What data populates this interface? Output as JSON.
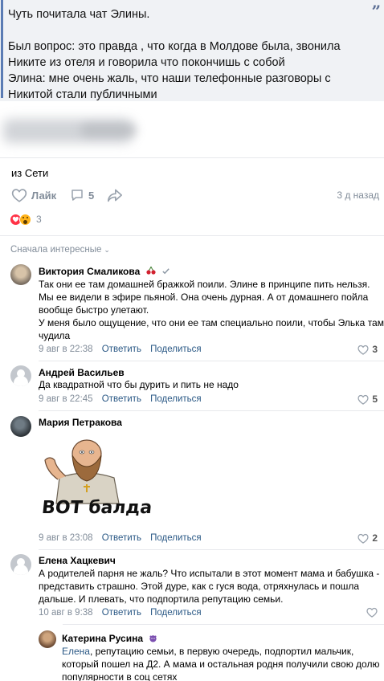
{
  "post": {
    "quote_lines": [
      "Чуть почитала чат Элины.",
      "",
      "Был вопрос: это правда , что когда в Молдове была, звонила",
      "Никите из отеля и говорила что покончишь с собой",
      "Элина: мне очень жаль, что наши телефонные разговоры с",
      "Никитой стали публичными"
    ],
    "quote_icon": "quote-mark-icon",
    "source": "из Сети",
    "like_label": "Лайк",
    "comments_count": "5",
    "time_ago": "3 д назад",
    "reactions_count": "3"
  },
  "comments_header": {
    "sort_label": "Сначала интересные"
  },
  "comments": [
    {
      "author": "Виктория Смаликова",
      "lines": [
        "Так они ее там домашней бражкой поили. Элине в принципе пить нельзя.",
        "Мы ее видели в эфире пьяной. Она очень дурная. А от домашнего пойла",
        "вообще быстро улетают.",
        "У меня было ощущение, что они ее там специально поили, чтобы Элька там",
        "чудила"
      ],
      "date": "9 авг в 22:38",
      "reply": "Ответить",
      "share": "Поделиться",
      "likes": "3"
    },
    {
      "author": "Андрей Васильев",
      "lines": [
        "Да квадратной что бы дурить и пить не надо"
      ],
      "date": "9 авг в 22:45",
      "reply": "Ответить",
      "share": "Поделиться",
      "likes": "5"
    },
    {
      "author": "Мария Петракова",
      "sticker_text": "ВОТ балда",
      "date": "9 авг в 23:08",
      "reply": "Ответить",
      "share": "Поделиться",
      "likes": "2"
    },
    {
      "author": "Елена Хацкевич",
      "lines": [
        "А родителей парня не жаль? Что испытали в этот момент мама и бабушка -",
        "представить страшно. Этой дуре, как с гуся вода, отряхнулась и пошла",
        "дальше. И плевать, что подпортила репутацию семьи."
      ],
      "date": "10 авг в 9:38",
      "reply": "Ответить",
      "share": "Поделиться"
    },
    {
      "author": "Катерина Русина",
      "mention": "Елена",
      "lines": [
        ", репутацию семьи, в первую очередь, подпортил мальчик,",
        "который пошел на Д2. А мама и остальная родня получили свою долю",
        "популярности в соц сетях"
      ]
    }
  ]
}
